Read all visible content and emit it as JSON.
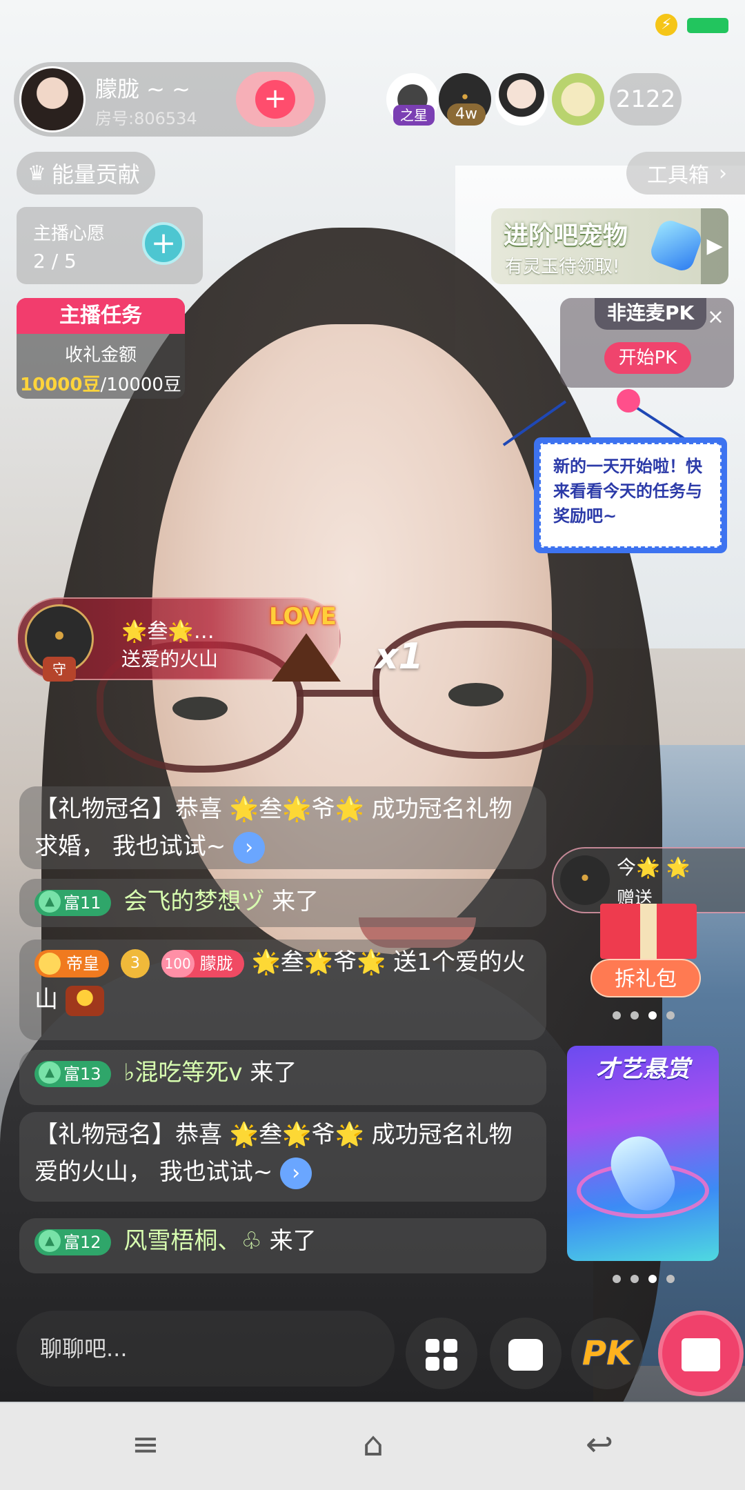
{
  "host": {
    "name": "朦胧 ~ ~",
    "room_label": "房号:806534",
    "follow_icon": "heart-plus-icon"
  },
  "viewers": {
    "badge_star": "之星",
    "badge_amount": "4w",
    "count": "2122"
  },
  "top_actions": {
    "energy_label": "能量贡献",
    "toolbox_label": "工具箱",
    "toolbox_arrow": "›"
  },
  "wish": {
    "title": "主播心愿",
    "progress": "2 / 5",
    "plus": "+"
  },
  "task": {
    "header": "主播任务",
    "label": "收礼金额",
    "current": "10000豆",
    "total": "/10000豆"
  },
  "pet_banner": {
    "title": "进阶吧宠物",
    "subtitle": "有灵玉待领取!",
    "arrow": "▶"
  },
  "pk_card": {
    "tab": "非连麦PK",
    "close": "×",
    "button": "开始PK"
  },
  "notice": {
    "text": "新的一天开始啦！快来看看今天的任务与奖励吧~"
  },
  "gift_banner": {
    "sender": "🌟叁🌟…",
    "text": "送爱的火山",
    "badge": "守",
    "gift_art": "LOVE",
    "count": "x1"
  },
  "chat": {
    "m1_prefix": "【礼物冠名】恭喜 🌟叁🌟爷🌟 成功冠名礼物求婚，",
    "m1_suffix": "我也试试~",
    "m2_level": "富11",
    "m2_user": "会飞的梦想ヅ",
    "m2_action": "来了",
    "m3_rank": "帝皇",
    "m3_level": "3",
    "m3_fan": "朦胧",
    "m3_user": "🌟叁🌟爷🌟",
    "m3_action": "送1个爱的火山",
    "m4_level": "富13",
    "m4_user": "♭混吃等死v",
    "m4_action": "来了",
    "m5_prefix": "【礼物冠名】恭喜 🌟叁🌟爷🌟 成功冠名礼物爱的火山，",
    "m5_suffix": "我也试试~",
    "m6_level": "富12",
    "m6_user": "风雪梧桐、♧",
    "m6_action": "来了",
    "more_icon": "›"
  },
  "right_promo": {
    "sender": "今🌟 🌟",
    "label": "赠送",
    "unpack": "拆礼包",
    "talent_title": "才艺悬赏"
  },
  "bottom": {
    "placeholder": "聊聊吧...",
    "pk_label": "PK"
  },
  "colors": {
    "accent_pink": "#f0416b",
    "task_red": "#f23d6d",
    "rich_green": "#2fa66a",
    "emperor_orange": "#f07a1f",
    "battery_green": "#22c55e"
  },
  "icons": [
    "lightning-icon",
    "battery-icon",
    "crown-icon",
    "chevron-right-icon",
    "plus-icon",
    "gem-icon",
    "close-icon",
    "grid-icon",
    "chat-bubble-icon",
    "gift-icon",
    "menu-icon",
    "home-icon",
    "back-icon"
  ]
}
